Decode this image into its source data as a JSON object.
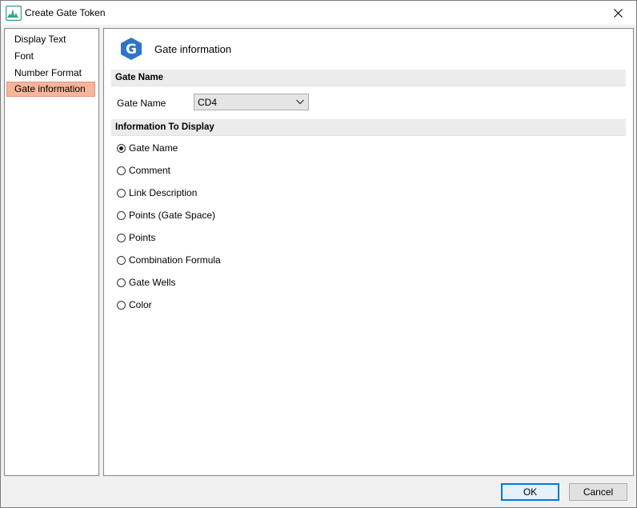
{
  "window": {
    "title": "Create Gate Token",
    "accent_color": "#0078d7"
  },
  "sidebar": {
    "items": [
      {
        "label": "Display Text",
        "selected": false
      },
      {
        "label": "Font",
        "selected": false
      },
      {
        "label": "Number Format",
        "selected": false
      },
      {
        "label": "Gate information",
        "selected": true
      }
    ],
    "selected_color": "#f7b59a"
  },
  "content": {
    "title": "Gate information",
    "logo_icon": "g-logo-icon",
    "logo_letter": "G",
    "logo_color": "#2e74c7",
    "gate_name_section": {
      "header": "Gate Name",
      "field_label": "Gate Name",
      "selected_value": "CD4"
    },
    "info_section": {
      "header": "Information To Display",
      "options": [
        {
          "label": "Gate Name",
          "checked": true
        },
        {
          "label": "Comment",
          "checked": false
        },
        {
          "label": "Link Description",
          "checked": false
        },
        {
          "label": "Points (Gate Space)",
          "checked": false
        },
        {
          "label": "Points",
          "checked": false
        },
        {
          "label": "Combination Formula",
          "checked": false
        },
        {
          "label": "Gate Wells",
          "checked": false
        },
        {
          "label": "Color",
          "checked": false
        }
      ]
    }
  },
  "footer": {
    "ok_label": "OK",
    "cancel_label": "Cancel"
  }
}
